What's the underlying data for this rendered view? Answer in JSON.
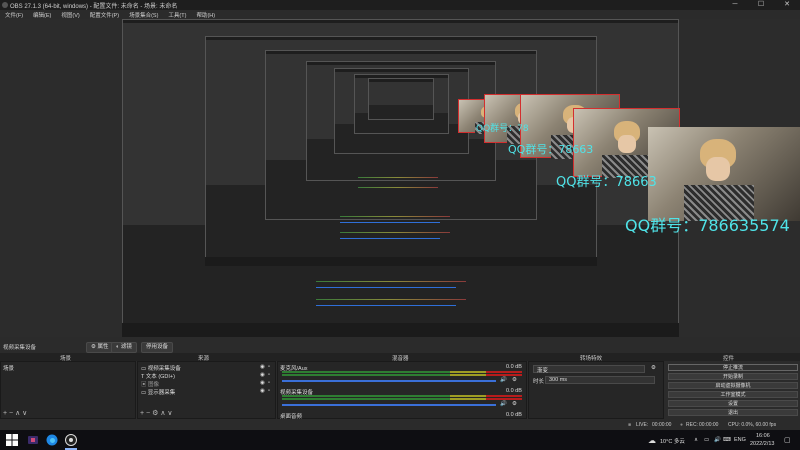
{
  "window": {
    "title": "OBS 27.1.3 (64-bit, windows) - 配置文件: 未命名 - 场景: 未命名",
    "controls": [
      "─",
      "☐",
      "✕"
    ]
  },
  "menu": [
    "文件(F)",
    "编辑(E)",
    "视图(V)",
    "配置文件(P)",
    "场景集合(S)",
    "工具(T)",
    "帮助(H)"
  ],
  "overlay_text": "QQ群号：786635574",
  "overlay_text_partial": [
    "QQ群号：78",
    "QQ群号：78663",
    "QQ群号：78663"
  ],
  "source_toolbar": {
    "source_name": "视频采集设备",
    "properties": "属性",
    "filters": "滤镜",
    "deactivate": "停用设备"
  },
  "docks": {
    "scenes": {
      "title": "场景",
      "items": [
        "场景"
      ]
    },
    "sources": {
      "title": "来源",
      "items": [
        "视频采集设备",
        "文本 (GDI+)",
        "图像",
        "显示器采集"
      ]
    },
    "mixer": {
      "title": "混音器",
      "channels": [
        {
          "name": "麦克风/Aux",
          "db": "0.0 dB"
        },
        {
          "name": "视频采集设备",
          "db": "0.0 dB"
        },
        {
          "name": "桌面音频",
          "db": "0.0 dB"
        }
      ]
    },
    "transitions": {
      "title": "转场特效",
      "type": "渐变",
      "duration_label": "时长",
      "duration": "300 ms"
    },
    "controls": {
      "title": "控件",
      "buttons": [
        "停止推流",
        "开始录制",
        "启动虚拟摄像机",
        "工作室模式",
        "设置",
        "退出"
      ]
    }
  },
  "status": {
    "live_label": "LIVE:",
    "live_time": "00:00:00",
    "rec_label": "REC:",
    "rec_time": "00:00:00",
    "cpu": "CPU: 0.0%, 60.00 fps"
  },
  "taskbar": {
    "weather": "10°C 多云",
    "lang": "ENG",
    "time": "16:06",
    "date": "2022/2/13"
  },
  "colors": {
    "accent_blue": "#2f6fd8",
    "overlay_cyan": "#4fe3e8",
    "selection_red": "#d32f2f"
  }
}
